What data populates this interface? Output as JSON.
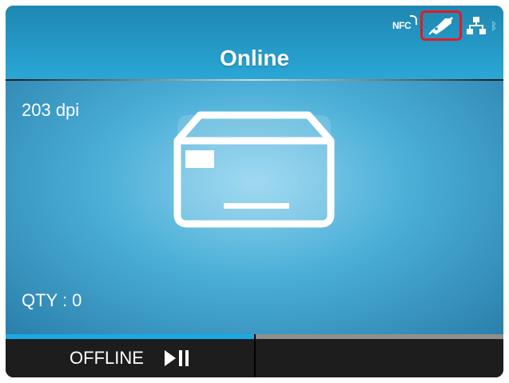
{
  "header": {
    "title": "Online",
    "status_icons": {
      "nfc_label": "NFC",
      "connect_icon": "wrench-connection-icon",
      "network_icon": "network-icon",
      "bluetooth_icon": "bluetooth-icon"
    },
    "highlight_color": "#e11b22"
  },
  "main": {
    "resolution": "203 dpi",
    "quantity": "QTY : 0",
    "center_icon": "label-media-icon"
  },
  "footer": {
    "offline_label": "OFFLINE",
    "offline_icon": "play-pause-icon",
    "active_tab_color": "#1aa9e4",
    "inactive_tab_color": "#8f8f8f"
  },
  "colors": {
    "header_bg": "#2aa7d6",
    "main_bg": "#4aaed6",
    "footer_bg": "#1d1d1d"
  }
}
